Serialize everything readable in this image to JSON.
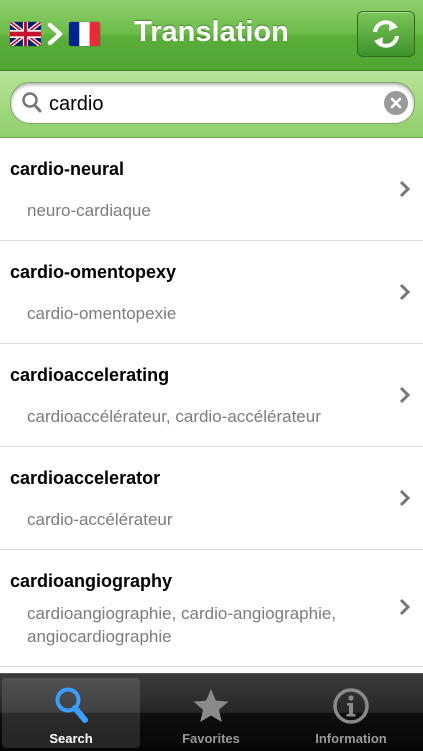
{
  "header": {
    "title": "Translation"
  },
  "search": {
    "value": "cardio",
    "placeholder": ""
  },
  "results": [
    {
      "term": "cardio-neural",
      "translation": "neuro-cardiaque"
    },
    {
      "term": "cardio-omentopexy",
      "translation": "cardio-omentopexie"
    },
    {
      "term": "cardioaccelerating",
      "translation": "cardioaccélérateur, cardio-accélérateur"
    },
    {
      "term": "cardioaccelerator",
      "translation": "cardio-accélérateur"
    },
    {
      "term": "cardioangiography",
      "translation": "cardioangiographie, cardio-angiographie, angiocardiographie"
    }
  ],
  "tabs": [
    {
      "label": "Search",
      "icon": "magnifier-icon"
    },
    {
      "label": "Favorites",
      "icon": "star-icon"
    },
    {
      "label": "Information",
      "icon": "info-icon"
    }
  ],
  "colors": {
    "accent_green": "#6dbc4a",
    "tab_active_icon": "#3aa0ff"
  }
}
